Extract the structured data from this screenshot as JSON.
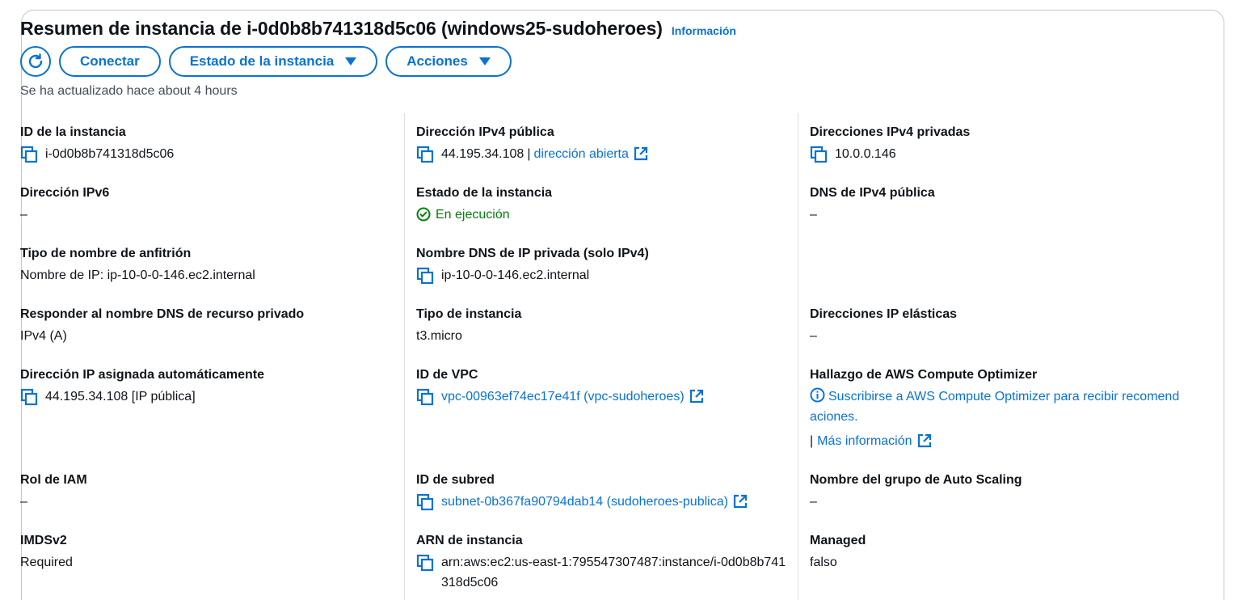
{
  "header": {
    "title": "Resumen de instancia de i-0d0b8b741318d5c06 (windows25-sudoheroes)",
    "info_link": "Información",
    "refresh_icon": "refresh-icon",
    "connect_label": "Conectar",
    "instance_state_label": "Estado de la instancia",
    "actions_label": "Acciones",
    "updated_text": "Se ha actualizado hace about 4 hours"
  },
  "fields": {
    "instance_id": {
      "label": "ID de la instancia",
      "value": "i-0d0b8b741318d5c06"
    },
    "ipv6": {
      "label": "Dirección IPv6",
      "value": "–"
    },
    "hostname_type": {
      "label": "Tipo de nombre de anfitrión",
      "value": "Nombre de IP: ip-10-0-0-146.ec2.internal"
    },
    "resource_dns": {
      "label": "Responder al nombre DNS de recurso privado",
      "value": "IPv4 (A)"
    },
    "auto_ip": {
      "label": "Dirección IP asignada automáticamente",
      "value": "44.195.34.108 [IP pública]"
    },
    "iam_role": {
      "label": "Rol de IAM",
      "value": "–"
    },
    "imdsv2": {
      "label": "IMDSv2",
      "value": "Required"
    },
    "public_ipv4": {
      "label": "Dirección IPv4 pública",
      "value": "44.195.34.108",
      "sep": "|",
      "link": "dirección abierta"
    },
    "instance_state": {
      "label": "Estado de la instancia",
      "value": "En ejecución"
    },
    "private_dns": {
      "label": "Nombre DNS de IP privada (solo IPv4)",
      "value": "ip-10-0-0-146.ec2.internal"
    },
    "instance_type": {
      "label": "Tipo de instancia",
      "value": "t3.micro"
    },
    "vpc_id": {
      "label": "ID de VPC",
      "value": "vpc-00963ef74ec17e41f (vpc-sudoheroes)"
    },
    "subnet_id": {
      "label": "ID de subred",
      "value": "subnet-0b367fa90794dab14 (sudoheroes-publica)"
    },
    "instance_arn": {
      "label": "ARN de instancia",
      "value": "arn:aws:ec2:us-east-1:795547307487:instance/i-0d0b8b741318d5c06"
    },
    "private_ipv4": {
      "label": "Direcciones IPv4 privadas",
      "value": "10.0.0.146"
    },
    "public_dns": {
      "label": "DNS de IPv4 pública",
      "value": "–"
    },
    "elastic_ip": {
      "label": "Direcciones IP elásticas",
      "value": "–"
    },
    "compute_optimizer": {
      "label": "Hallazgo de AWS Compute Optimizer",
      "link": "Suscribirse a AWS Compute Optimizer para recibir recomendaciones.",
      "sep": "|",
      "more": "Más información"
    },
    "asg_name": {
      "label": "Nombre del grupo de Auto Scaling",
      "value": "–"
    },
    "managed": {
      "label": "Managed",
      "value": "falso"
    }
  },
  "colors": {
    "accent": "#0972d3",
    "success": "#037f0c",
    "text": "#0f141a"
  }
}
